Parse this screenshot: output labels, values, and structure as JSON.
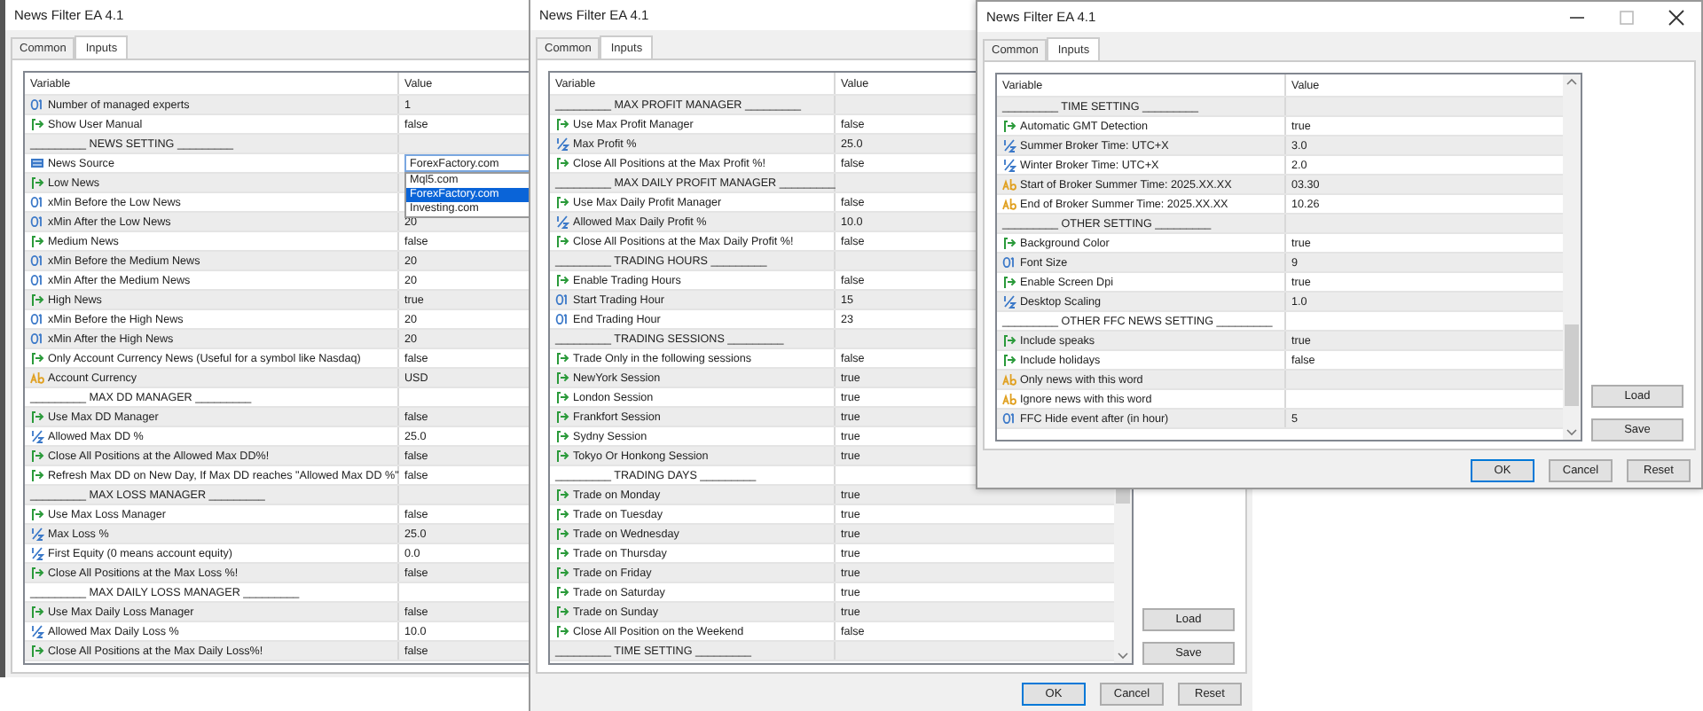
{
  "windows": [
    {
      "title": "News Filter EA 4.1",
      "tabs": [
        {
          "label": "Common",
          "selected": false
        },
        {
          "label": "Inputs",
          "selected": true
        }
      ],
      "columns": [
        "Variable",
        "Value"
      ],
      "rows": [
        {
          "kind": "int",
          "name": "Number of managed experts",
          "value": "1"
        },
        {
          "kind": "bool",
          "name": "Show User Manual",
          "value": "false"
        },
        {
          "kind": "section",
          "name": "_________ NEWS SETTING _________"
        },
        {
          "kind": "enum",
          "name": "News Source",
          "value": "ForexFactory.com",
          "options": [
            {
              "label": "Mql5.com",
              "selected": false
            },
            {
              "label": "ForexFactory.com",
              "selected": true
            },
            {
              "label": "Investing.com",
              "selected": false
            }
          ]
        },
        {
          "kind": "bool",
          "name": "Low News"
        },
        {
          "kind": "int",
          "name": "xMin Before the Low News"
        },
        {
          "kind": "int",
          "name": "xMin After the Low News",
          "value": "20"
        },
        {
          "kind": "bool",
          "name": "Medium News",
          "value": "false"
        },
        {
          "kind": "int",
          "name": "xMin Before the Medium News",
          "value": "20"
        },
        {
          "kind": "int",
          "name": "xMin After the Medium News",
          "value": "20"
        },
        {
          "kind": "bool",
          "name": "High News",
          "value": "true"
        },
        {
          "kind": "int",
          "name": "xMin Before the High News",
          "value": "20"
        },
        {
          "kind": "int",
          "name": "xMin After the High News",
          "value": "20"
        },
        {
          "kind": "bool",
          "name": "Only Account Currency News (Useful for a symbol like Nasdaq)",
          "value": "false"
        },
        {
          "kind": "string",
          "name": "Account Currency",
          "value": "USD"
        },
        {
          "kind": "section",
          "name": "_________ MAX DD MANAGER _________"
        },
        {
          "kind": "bool",
          "name": "Use Max DD Manager",
          "value": "false"
        },
        {
          "kind": "double",
          "name": "Allowed Max DD %",
          "value": "25.0"
        },
        {
          "kind": "bool",
          "name": "Close All Positions at the Allowed Max DD%!",
          "value": "false"
        },
        {
          "kind": "bool",
          "name": "Refresh Max DD on New Day, If Max DD reaches \"Allowed Max DD %\"",
          "value": "false"
        },
        {
          "kind": "section",
          "name": "_________ MAX LOSS MANAGER _________"
        },
        {
          "kind": "bool",
          "name": "Use Max Loss Manager",
          "value": "false"
        },
        {
          "kind": "double",
          "name": "Max Loss %",
          "value": "25.0"
        },
        {
          "kind": "double",
          "name": "First Equity (0 means account equity)",
          "value": "0.0"
        },
        {
          "kind": "bool",
          "name": "Close All Positions at the Max Loss %!",
          "value": "false"
        },
        {
          "kind": "section",
          "name": "_________ MAX DAILY LOSS MANAGER _________"
        },
        {
          "kind": "bool",
          "name": "Use Max Daily Loss Manager",
          "value": "false"
        },
        {
          "kind": "double",
          "name": "Allowed Max Daily Loss %",
          "value": "10.0"
        },
        {
          "kind": "bool",
          "name": "Close All Positions at the Max Daily Loss%!",
          "value": "false"
        }
      ]
    },
    {
      "title": "News Filter EA 4.1",
      "tabs": [
        {
          "label": "Common",
          "selected": false
        },
        {
          "label": "Inputs",
          "selected": true
        }
      ],
      "columns": [
        "Variable",
        "Value"
      ],
      "rows": [
        {
          "kind": "section",
          "name": "_________ MAX PROFIT MANAGER _________"
        },
        {
          "kind": "bool",
          "name": "Use Max Profit Manager",
          "value": "false"
        },
        {
          "kind": "double",
          "name": "Max Profit %",
          "value": "25.0"
        },
        {
          "kind": "bool",
          "name": "Close All Positions at the Max Profit %!",
          "value": "false"
        },
        {
          "kind": "section",
          "name": "_________ MAX DAILY PROFIT MANAGER _________"
        },
        {
          "kind": "bool",
          "name": "Use Max Daily Profit Manager",
          "value": "false"
        },
        {
          "kind": "double",
          "name": "Allowed Max Daily Profit %",
          "value": "10.0"
        },
        {
          "kind": "bool",
          "name": "Close All Positions at the Max Daily Profit %!",
          "value": "false"
        },
        {
          "kind": "section",
          "name": "_________ TRADING HOURS _________"
        },
        {
          "kind": "bool",
          "name": "Enable Trading Hours",
          "value": "false"
        },
        {
          "kind": "int",
          "name": "Start Trading Hour",
          "value": "15"
        },
        {
          "kind": "int",
          "name": "End Trading Hour",
          "value": "23"
        },
        {
          "kind": "section",
          "name": "_________ TRADING SESSIONS _________"
        },
        {
          "kind": "bool",
          "name": "Trade Only in the following sessions",
          "value": "false"
        },
        {
          "kind": "bool",
          "name": "NewYork Session",
          "value": "true"
        },
        {
          "kind": "bool",
          "name": "London Session",
          "value": "true"
        },
        {
          "kind": "bool",
          "name": "Frankfort Session",
          "value": "true"
        },
        {
          "kind": "bool",
          "name": "Sydny Session",
          "value": "true"
        },
        {
          "kind": "bool",
          "name": "Tokyo Or Honkong Session",
          "value": "true"
        },
        {
          "kind": "section",
          "name": "_________ TRADING DAYS _________"
        },
        {
          "kind": "bool",
          "name": "Trade on Monday",
          "value": "true"
        },
        {
          "kind": "bool",
          "name": "Trade on Tuesday",
          "value": "true"
        },
        {
          "kind": "bool",
          "name": "Trade on Wednesday",
          "value": "true"
        },
        {
          "kind": "bool",
          "name": "Trade on Thursday",
          "value": "true"
        },
        {
          "kind": "bool",
          "name": "Trade on Friday",
          "value": "true"
        },
        {
          "kind": "bool",
          "name": "Trade on Saturday",
          "value": "true"
        },
        {
          "kind": "bool",
          "name": "Trade on Sunday",
          "value": "true"
        },
        {
          "kind": "bool",
          "name": "Close All Position on the Weekend",
          "value": "false"
        },
        {
          "kind": "section",
          "name": "_________ TIME SETTING _________"
        }
      ],
      "side_buttons": [
        "Load",
        "Save"
      ],
      "buttons": [
        "OK",
        "Cancel",
        "Reset"
      ]
    },
    {
      "title": "News Filter EA 4.1",
      "title_buttons": true,
      "tabs": [
        {
          "label": "Common",
          "selected": false
        },
        {
          "label": "Inputs",
          "selected": true
        }
      ],
      "columns": [
        "Variable",
        "Value"
      ],
      "rows": [
        {
          "kind": "section",
          "name": "_________ TIME SETTING _________"
        },
        {
          "kind": "bool",
          "name": "Automatic GMT Detection",
          "value": "true"
        },
        {
          "kind": "double",
          "name": "Summer Broker Time: UTC+X",
          "value": "3.0"
        },
        {
          "kind": "double",
          "name": "Winter Broker Time: UTC+X",
          "value": "2.0"
        },
        {
          "kind": "string",
          "name": "Start of Broker Summer Time: 2025.XX.XX",
          "value": "03.30"
        },
        {
          "kind": "string",
          "name": "End of Broker Summer Time: 2025.XX.XX",
          "value": "10.26"
        },
        {
          "kind": "section",
          "name": "_________ OTHER SETTING _________"
        },
        {
          "kind": "bool",
          "name": "Background Color",
          "value": "true"
        },
        {
          "kind": "int",
          "name": "Font Size",
          "value": "9"
        },
        {
          "kind": "bool",
          "name": "Enable Screen Dpi",
          "value": "true"
        },
        {
          "kind": "double",
          "name": "Desktop Scaling",
          "value": "1.0"
        },
        {
          "kind": "section",
          "name": "_________ OTHER FFC NEWS SETTING _________"
        },
        {
          "kind": "bool",
          "name": "Include speaks",
          "value": "true"
        },
        {
          "kind": "bool",
          "name": "Include holidays",
          "value": "false"
        },
        {
          "kind": "string",
          "name": "Only news with this word"
        },
        {
          "kind": "string",
          "name": "Ignore news with this word"
        },
        {
          "kind": "int",
          "name": "FFC Hide event after (in hour)",
          "value": "5"
        }
      ],
      "side_buttons": [
        "Load",
        "Save"
      ],
      "buttons": [
        "OK",
        "Cancel",
        "Reset"
      ]
    }
  ]
}
